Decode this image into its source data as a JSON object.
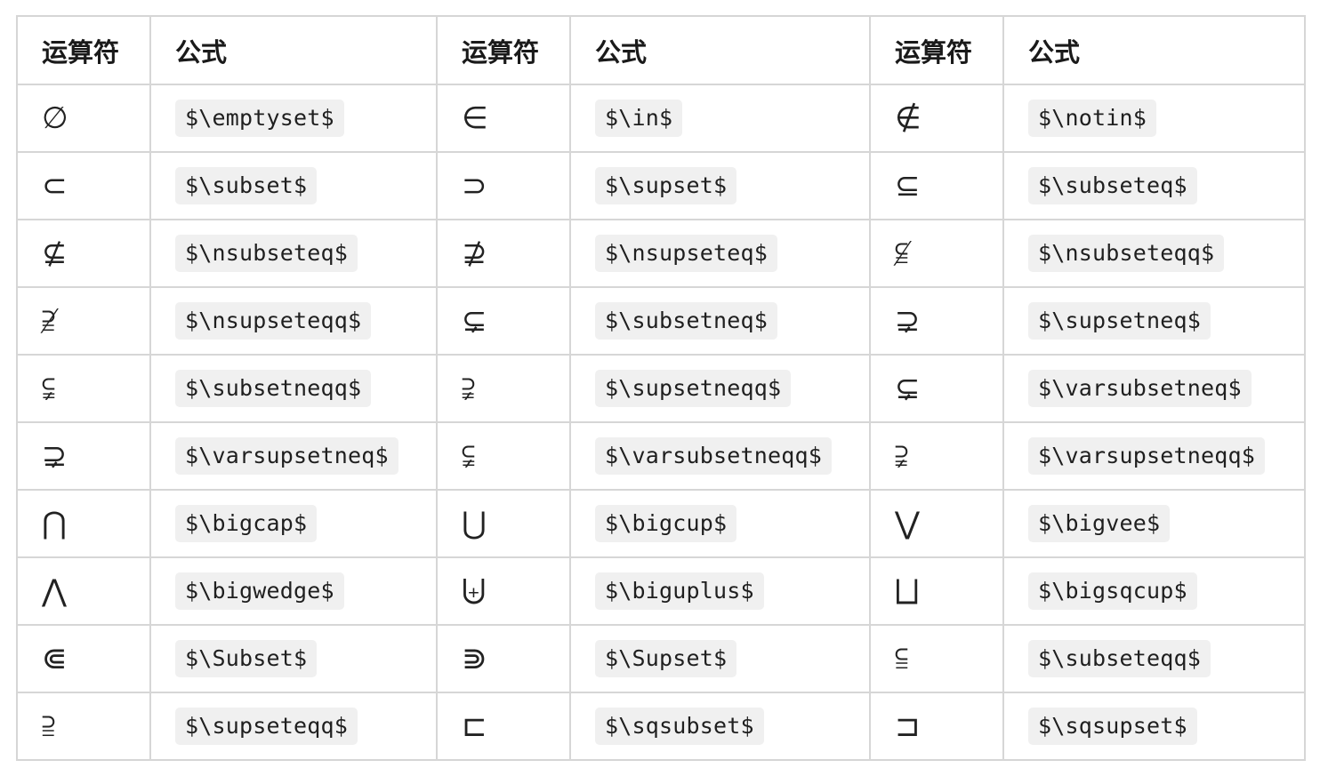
{
  "table": {
    "headers": [
      "运算符",
      "公式",
      "运算符",
      "公式",
      "运算符",
      "公式"
    ],
    "rows": [
      [
        {
          "symbol": "∅",
          "formula": "$\\emptyset$"
        },
        {
          "symbol": "∈",
          "formula": "$\\in$"
        },
        {
          "symbol": "∉",
          "formula": "$\\notin$"
        }
      ],
      [
        {
          "symbol": "⊂",
          "formula": "$\\subset$"
        },
        {
          "symbol": "⊃",
          "formula": "$\\supset$"
        },
        {
          "symbol": "⊆",
          "formula": "$\\subseteq$"
        }
      ],
      [
        {
          "symbol": "⊈",
          "formula": "$\\nsubseteq$"
        },
        {
          "symbol": "⊉",
          "formula": "$\\nsupseteq$"
        },
        {
          "symbol": "⫅̸",
          "formula": "$\\nsubseteqq$"
        }
      ],
      [
        {
          "symbol": "⫆̸",
          "formula": "$\\nsupseteqq$"
        },
        {
          "symbol": "⊊",
          "formula": "$\\subsetneq$"
        },
        {
          "symbol": "⊋",
          "formula": "$\\supsetneq$"
        }
      ],
      [
        {
          "symbol": "⫋",
          "formula": "$\\subsetneqq$"
        },
        {
          "symbol": "⫌",
          "formula": "$\\supsetneqq$"
        },
        {
          "symbol": "⊊",
          "formula": "$\\varsubsetneq$"
        }
      ],
      [
        {
          "symbol": "⊋",
          "formula": "$\\varsupsetneq$"
        },
        {
          "symbol": "⫋",
          "formula": "$\\varsubsetneqq$"
        },
        {
          "symbol": "⫌",
          "formula": "$\\varsupsetneqq$"
        }
      ],
      [
        {
          "symbol": "⋂",
          "formula": "$\\bigcap$"
        },
        {
          "symbol": "⋃",
          "formula": "$\\bigcup$"
        },
        {
          "symbol": "⋁",
          "formula": "$\\bigvee$"
        }
      ],
      [
        {
          "symbol": "⋀",
          "formula": "$\\bigwedge$"
        },
        {
          "symbol": "⨄",
          "formula": "$\\biguplus$"
        },
        {
          "symbol": "⨆",
          "formula": "$\\bigsqcup$"
        }
      ],
      [
        {
          "symbol": "⋐",
          "formula": "$\\Subset$"
        },
        {
          "symbol": "⋑",
          "formula": "$\\Supset$"
        },
        {
          "symbol": "⫅",
          "formula": "$\\subseteqq$"
        }
      ],
      [
        {
          "symbol": "⫆",
          "formula": "$\\supseteqq$"
        },
        {
          "symbol": "⊏",
          "formula": "$\\sqsubset$"
        },
        {
          "symbol": "⊐",
          "formula": "$\\sqsupset$"
        }
      ]
    ]
  }
}
